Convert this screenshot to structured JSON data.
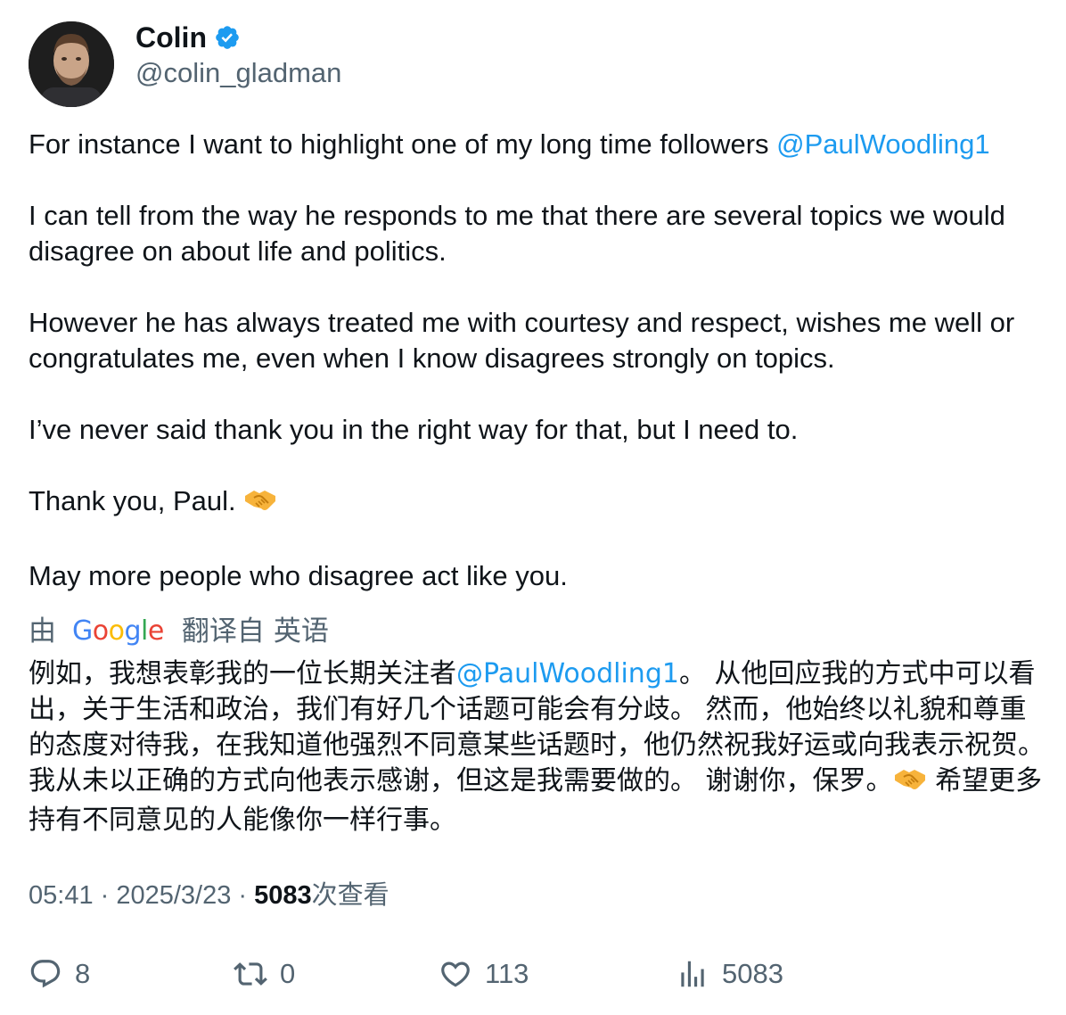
{
  "author": {
    "display_name": "Colin",
    "handle": "@colin_gladman",
    "verified_color": "#1d9bf0"
  },
  "tweet": {
    "para1_text": "For instance I want to highlight one of my long time followers ",
    "para1_mention": "@PaulWoodling1",
    "para2": "I can tell from the way he responds to me that there are several topics we would disagree on about life and politics.",
    "para3": "However he has always treated me with courtesy and respect, wishes me well or congratulates me, even when I know disagrees strongly on topics.",
    "para4": "I’ve never said thank you in the right way for that, but I need to.",
    "para5_text": "Thank you, Paul. ",
    "para5_emoji": "handshake-emoji",
    "para6": "May more people who disagree act like you."
  },
  "translation_bar": {
    "by": "由",
    "google_G": "G",
    "google_o1": "o",
    "google_o2": "o",
    "google_g": "g",
    "google_l": "l",
    "google_e": "e",
    "translated_from": "翻译自",
    "language": "英语"
  },
  "translation": {
    "part1": "例如，我想表彰我的一位长期关注者",
    "mention": "@PaulWoodling1",
    "part2": "。 从他回应我的方式中可以看出，关于生活和政治，我们有好几个话题可能会有分歧。 然而，他始终以礼貌和尊重的态度对待我，在我知道他强烈不同意某些话题时，他仍然祝我好运或向我表示祝贺。 我从未以正确的方式向他表示感谢，但这是我需要做的。 谢谢你，保罗。",
    "part3": " 希望更多持有不同意见的人能像你一样行事。"
  },
  "meta": {
    "time": "05:41",
    "sep1": " · ",
    "date": "2025/3/23",
    "sep2": " · ",
    "views_count": "5083",
    "views_label": "次查看"
  },
  "actions": {
    "replies": "8",
    "retweets": "0",
    "likes": "113",
    "views": "5083"
  }
}
